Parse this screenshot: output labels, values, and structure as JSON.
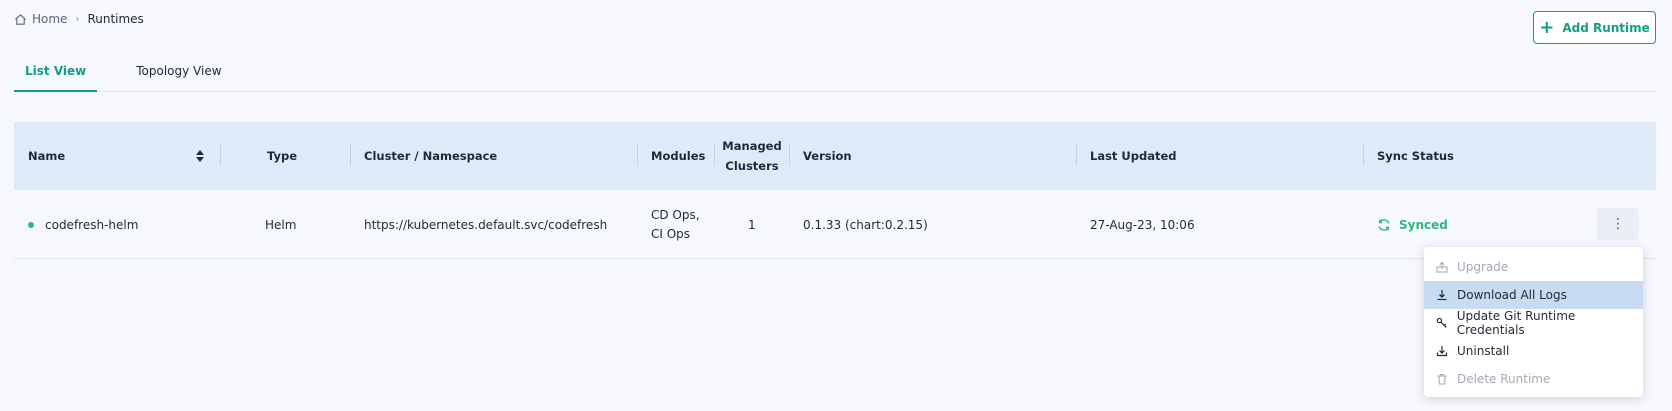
{
  "breadcrumb": {
    "home": "Home",
    "separator": "›",
    "current": "Runtimes"
  },
  "header": {
    "add_button": "Add Runtime",
    "add_icon": "plus-icon"
  },
  "tabs": [
    {
      "label": "List View",
      "active": true
    },
    {
      "label": "Topology View",
      "active": false
    }
  ],
  "table": {
    "columns": {
      "name": "Name",
      "type": "Type",
      "cluster": "Cluster / Namespace",
      "modules": "Modules",
      "managed_line1": "Managed",
      "managed_line2": "Clusters",
      "version": "Version",
      "updated": "Last Updated",
      "sync": "Sync Status"
    },
    "rows": [
      {
        "name": "codefresh-helm",
        "type": "Helm",
        "cluster": "https://kubernetes.default.svc/codefresh",
        "modules_line1": "CD Ops,",
        "modules_line2": "CI Ops",
        "managed": "1",
        "version": "0.1.33 (chart:0.2.15)",
        "updated": "27-Aug-23, 10:06",
        "sync": "Synced"
      }
    ]
  },
  "menu": {
    "items": [
      {
        "label": "Upgrade",
        "icon": "upgrade-icon",
        "state": "disabled"
      },
      {
        "label": "Download All Logs",
        "icon": "download-icon",
        "state": "hovered"
      },
      {
        "label": "Update Git Runtime Credentials",
        "icon": "key-icon",
        "state": "enabled"
      },
      {
        "label": "Uninstall",
        "icon": "uninstall-icon",
        "state": "enabled"
      },
      {
        "label": "Delete Runtime",
        "icon": "trash-icon",
        "state": "disabled"
      }
    ]
  },
  "colors": {
    "accent": "#149d86",
    "synced": "#2db87c",
    "header_bg": "#dfeaf8",
    "hover_bg": "#c7dcf0"
  }
}
